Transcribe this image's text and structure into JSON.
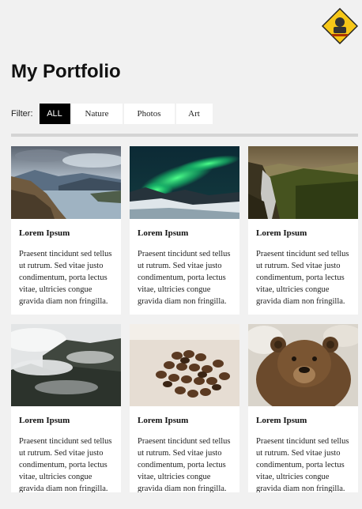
{
  "header": {
    "title": "My Portfolio"
  },
  "filter": {
    "label": "Filter:",
    "buttons": [
      {
        "label": "ALL",
        "active": true
      },
      {
        "label": "Nature",
        "active": false
      },
      {
        "label": "Photos",
        "active": false
      },
      {
        "label": "Art",
        "active": false
      }
    ]
  },
  "cards": [
    {
      "title": "Lorem Ipsum",
      "text": "Praesent tincidunt sed tellus ut rutrum. Sed vitae justo condimentum, porta lectus vitae, ultricies congue gravida diam non fringilla.",
      "image": "mountain-lake-photo"
    },
    {
      "title": "Lorem Ipsum",
      "text": "Praesent tincidunt sed tellus ut rutrum. Sed vitae justo condimentum, porta lectus vitae, ultricies congue gravida diam non fringilla.",
      "image": "northern-lights-photo"
    },
    {
      "title": "Lorem Ipsum",
      "text": "Praesent tincidunt sed tellus ut rutrum. Sed vitae justo condimentum, porta lectus vitae, ultricies congue gravida diam non fringilla.",
      "image": "forest-valley-photo"
    },
    {
      "title": "Lorem Ipsum",
      "text": "Praesent tincidunt sed tellus ut rutrum. Sed vitae justo condimentum, porta lectus vitae, ultricies congue gravida diam non fringilla.",
      "image": "misty-forest-photo"
    },
    {
      "title": "Lorem Ipsum",
      "text": "Praesent tincidunt sed tellus ut rutrum. Sed vitae justo condimentum, porta lectus vitae, ultricies congue gravida diam non fringilla.",
      "image": "coffee-beans-photo"
    },
    {
      "title": "Lorem Ipsum",
      "text": "Praesent tincidunt sed tellus ut rutrum. Sed vitae justo condimentum, porta lectus vitae, ultricies congue gravida diam non fringilla.",
      "image": "brown-bear-photo"
    }
  ],
  "colors": {
    "page_background": "#f1f1f1",
    "active_filter": "#000000",
    "card_background": "#ffffff",
    "divider": "#d4d4d4",
    "logo": "#f6c718"
  }
}
